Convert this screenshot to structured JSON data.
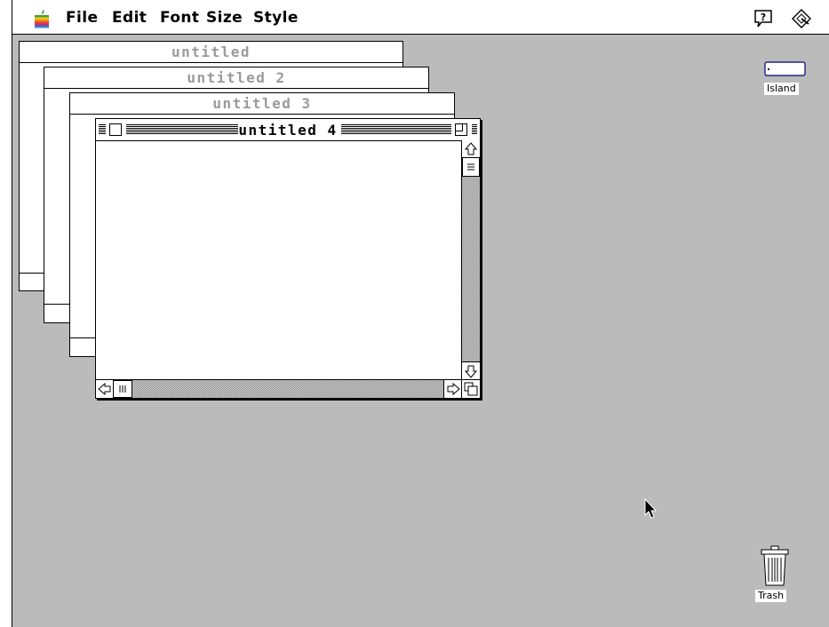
{
  "menubar": {
    "items": [
      {
        "label": "File"
      },
      {
        "label": "Edit"
      },
      {
        "label": "Font"
      },
      {
        "label": "Size"
      },
      {
        "label": "Style"
      }
    ],
    "apple_icon": "apple-menu-icon",
    "help_icon": "balloon-help-icon",
    "app_icon": "application-menu-icon"
  },
  "windows": [
    {
      "title": "untitled",
      "active": false
    },
    {
      "title": "untitled 2",
      "active": false
    },
    {
      "title": "untitled 3",
      "active": false
    },
    {
      "title": "untitled 4",
      "active": true
    }
  ],
  "desktop": {
    "disk": {
      "label": "Island",
      "icon": "disk-icon"
    },
    "trash": {
      "label": "Trash",
      "icon": "trash-icon"
    }
  },
  "colors": {
    "desktop": "#bbbbbb",
    "inactive_title": "#9a9a9a",
    "menubar": "#ffffff"
  }
}
